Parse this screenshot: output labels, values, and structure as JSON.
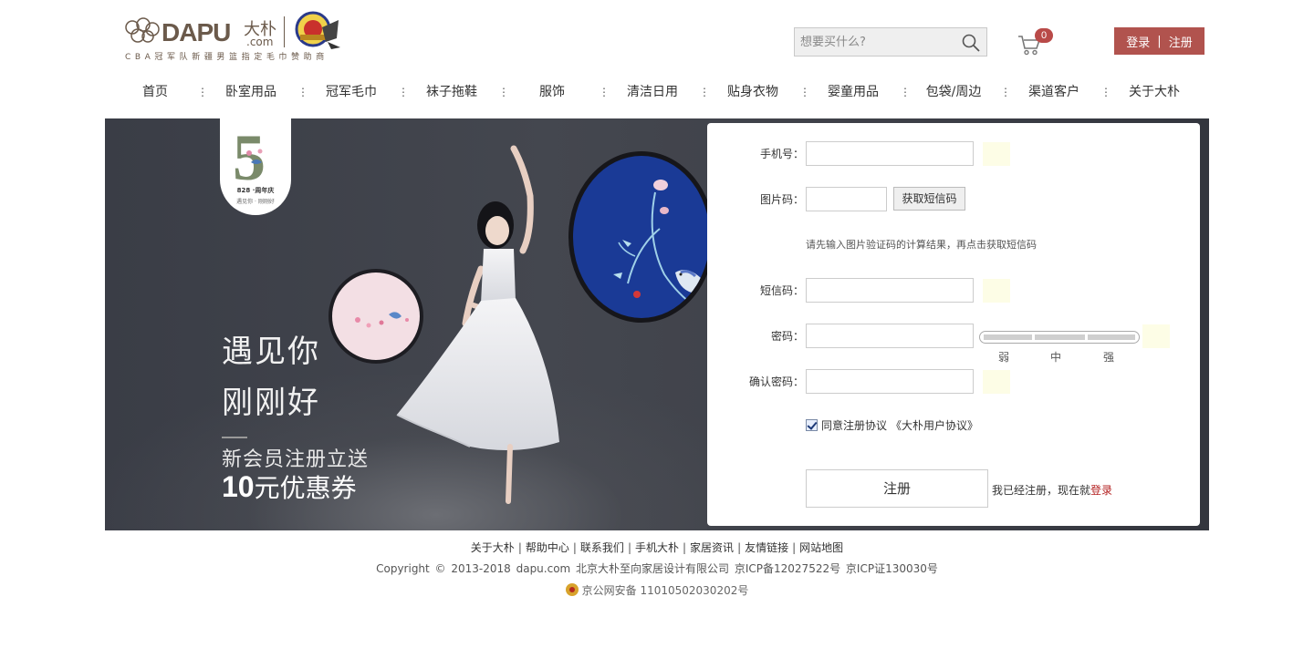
{
  "header": {
    "brand": "DAPU",
    "brand_cn": "大朴",
    "brand_com": ".com",
    "tagline": "CBA冠军队新疆男篮指定毛巾赞助商",
    "search_placeholder": "想要买什么?",
    "cart_count": "0",
    "login_label": "登录",
    "auth_divider": "|",
    "register_label": "注册"
  },
  "nav": {
    "items": [
      {
        "label": "首页"
      },
      {
        "label": "卧室用品"
      },
      {
        "label": "冠军毛巾"
      },
      {
        "label": "袜子拖鞋"
      },
      {
        "label": "服饰"
      },
      {
        "label": "清洁日用"
      },
      {
        "label": "贴身衣物"
      },
      {
        "label": "婴童用品"
      },
      {
        "label": "包袋/周边"
      },
      {
        "label": "渠道客户"
      },
      {
        "label": "关于大朴"
      }
    ],
    "separator": "⋮"
  },
  "banner": {
    "badge_number": "5",
    "badge_caption": "828 ·周年庆",
    "badge_sub": "遇见你 · 刚刚好",
    "slogan_line1": "遇见你",
    "slogan_line2": "刚刚好",
    "slogan_line3": "新会员注册立送",
    "coupon_amount": "10",
    "coupon_text": "元优惠券"
  },
  "form": {
    "phone_label": "手机号：",
    "captcha_label": "图片码：",
    "sms_button": "获取短信码",
    "tip": "请先输入图片验证码的计算结果，再点击获取短信码",
    "sms_label": "短信码：",
    "password_label": "密码：",
    "strength_weak": "弱",
    "strength_mid": "中",
    "strength_strong": "强",
    "confirm_label": "确认密码：",
    "agree_text": "同意注册协议",
    "agreement_link": "《大朴用户协议》",
    "agree_checked": true,
    "register_button": "注册",
    "have_account": "我已经注册，现在就",
    "login_link": "登录"
  },
  "footer": {
    "links": [
      "关于大朴",
      "帮助中心",
      "联系我们",
      "手机大朴",
      "家居资讯",
      "友情链接",
      "网站地图"
    ],
    "copyright": "Copyright  ©  2013-2018  dapu.com  北京大朴至向家居设计有限公司   京ICP备12027522号  京ICP证130030号",
    "police": "京公网安备 11010502030202号"
  },
  "colors": {
    "accent": "#b1534e",
    "brand": "#6b5a4b",
    "link_red": "#b32020"
  }
}
